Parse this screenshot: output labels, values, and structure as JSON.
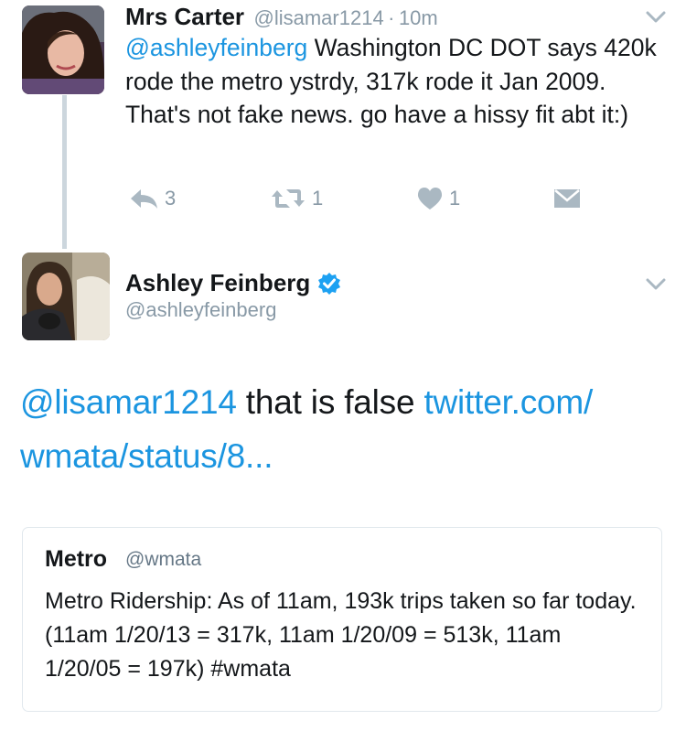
{
  "tweet1": {
    "author_name": "Mrs Carter",
    "author_handle": "@lisamar1214",
    "separator": "·",
    "time": "10m",
    "mention": "@ashleyfeinberg",
    "text": " Washington DC DOT says 420k rode the metro ystrdy, 317k rode it Jan 2009. That's not fake news. go have a hissy fit abt it:)",
    "reply_count": "3",
    "retweet_count": "1",
    "like_count": "1"
  },
  "tweet2": {
    "author_name": "Ashley Feinberg",
    "author_handle": "@ashleyfeinberg",
    "verified": true,
    "mention": "@lisamar1214",
    "text": " that is false ",
    "link_text": "twitter.com/ wmata/status/8...",
    "quote": {
      "author_name": "Metro",
      "author_handle": "@wmata",
      "text": "Metro Ridership: As of 11am, 193k trips taken so far today. (11am 1/20/13 = 317k, 11am 1/20/09 = 513k, 11am 1/20/05 = 197k) #wmata"
    }
  },
  "icons": {
    "reply": "reply-icon",
    "retweet": "retweet-icon",
    "like": "heart-icon",
    "dm": "envelope-icon",
    "more": "chevron-down-icon",
    "verified": "verified-badge-icon"
  },
  "colors": {
    "link": "#1b95e0",
    "secondary_text": "#8899a6",
    "border": "#e1e8ed",
    "thread_line": "#ccd6dd",
    "verified": "#1da1f2"
  }
}
